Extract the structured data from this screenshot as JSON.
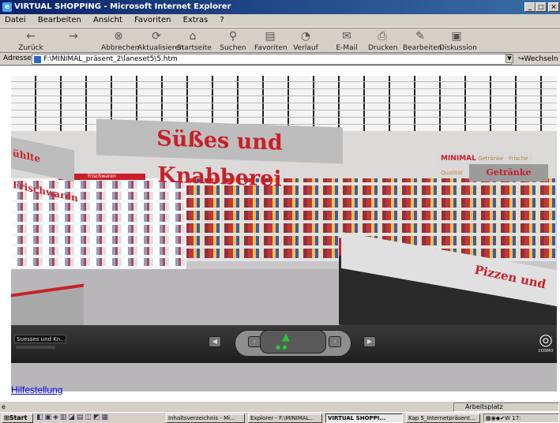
{
  "window": {
    "title": "VIRTUAL SHOPPING - Microsoft Internet Explorer"
  },
  "menu": [
    "Datei",
    "Bearbeiten",
    "Ansicht",
    "Favoriten",
    "Extras",
    "?"
  ],
  "toolbar": [
    {
      "label": "Zurück",
      "icon": "back-arrow-icon"
    },
    {
      "label": "",
      "icon": "forward-arrow-icon"
    },
    {
      "label": "Abbrechen",
      "icon": "stop-icon"
    },
    {
      "label": "Aktualisieren",
      "icon": "refresh-icon"
    },
    {
      "label": "Startseite",
      "icon": "home-icon"
    },
    {
      "label": "Suchen",
      "icon": "search-icon"
    },
    {
      "label": "Favoriten",
      "icon": "favorites-icon"
    },
    {
      "label": "Verlauf",
      "icon": "history-icon"
    },
    {
      "label": "E-Mail",
      "icon": "mail-icon"
    },
    {
      "label": "Drucken",
      "icon": "print-icon"
    },
    {
      "label": "Bearbeiten",
      "icon": "edit-icon"
    },
    {
      "label": "Diskussion",
      "icon": "discuss-icon"
    }
  ],
  "address": {
    "label": "Adresse",
    "value": "F:\\MINIMAL_präsent_2\\laneset5\\5.htm",
    "go": "Wechseln z"
  },
  "scene": {
    "sign_main": "Süßes und Knabberei",
    "sign_left": "ühlte Frischwaren",
    "sign_shelf_label": "Frischwaren",
    "sign_right_top": "MINIMAL",
    "sign_right_top_sub": "Getränke · Frische · Qualität",
    "sign_right": "Getränke",
    "sign_pizza": "Pizzen und"
  },
  "navigation": {
    "location_field": "Suesses und Kn...",
    "logo_text": "COSMO"
  },
  "help_link": "Hilfestellung",
  "status": {
    "zone": "Arbeitsplatz"
  },
  "taskbar": {
    "start": "Start",
    "tasks": [
      {
        "label": "Inhaltsverzeichnis - Mi..."
      },
      {
        "label": "Explorer - F:\\MINIMAL..."
      },
      {
        "label": "VIRTUAL SHOPPI..."
      },
      {
        "label": "Kap 5_Internetpräsent..."
      }
    ],
    "clock": "17:"
  }
}
